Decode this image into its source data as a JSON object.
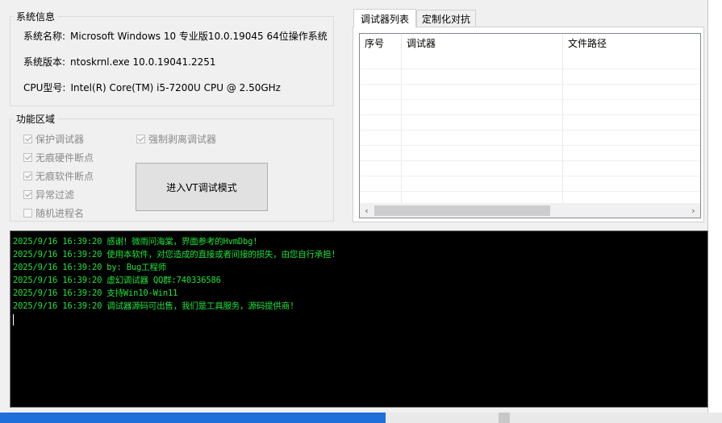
{
  "system_info": {
    "legend": "系统信息",
    "os_name_label": "系统名称:",
    "os_name_value": "Microsoft Windows 10 专业版10.0.19045  64位操作系统",
    "os_version_label": "系统版本:",
    "os_version_value": "ntoskrnl.exe  10.0.19041.2251",
    "cpu_label": "CPU型号:",
    "cpu_value": "Intel(R) Core(TM) i5-7200U CPU @ 2.50GHz"
  },
  "features": {
    "legend": "功能区域",
    "checkboxes": [
      {
        "label": "保护调试器",
        "checked": true
      },
      {
        "label": "无痕硬件断点",
        "checked": true
      },
      {
        "label": "无痕软件断点",
        "checked": true
      },
      {
        "label": "异常过滤",
        "checked": true
      },
      {
        "label": "随机进程名",
        "checked": false
      },
      {
        "label": "强制剥离调试器",
        "checked": true
      }
    ],
    "vt_button": "进入VT调试模式"
  },
  "tabs": [
    {
      "label": "调试器列表",
      "active": true
    },
    {
      "label": "定制化对抗",
      "active": false
    }
  ],
  "debugger_list": {
    "columns": [
      "序号",
      "调试器",
      "文件路径"
    ]
  },
  "log": {
    "lines": [
      "2025/9/16 16:39:20 感谢！微雨问海棠，界面参考的HvmDbg!",
      "2025/9/16 16:39:20 使用本软件，对您造成的直接或者间接的损失，由您自行承担!",
      "2025/9/16 16:39:20 by: Bug工程师",
      "2025/9/16 16:39:20 虚幻调试器 QQ群:740336586",
      "2025/9/16 16:39:20 支持Win10-Win11",
      "2025/9/16 16:39:20 调试器源码可出售，我们是工具服务，源码提供商!"
    ]
  },
  "colors": {
    "log_text": "#21e13c",
    "console_bg": "#000000",
    "window_bg": "#f0f0f0"
  }
}
